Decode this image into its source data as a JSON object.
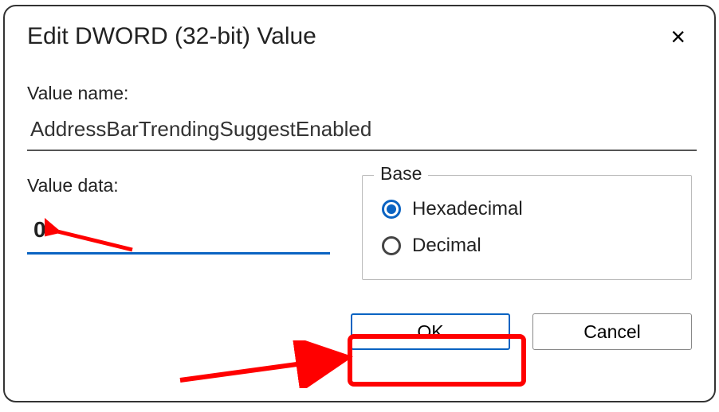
{
  "dialog": {
    "title": "Edit DWORD (32-bit) Value",
    "close_icon": "×"
  },
  "value_name": {
    "label": "Value name:",
    "value": "AddressBarTrendingSuggestEnabled"
  },
  "value_data": {
    "label": "Value data:",
    "value": "0"
  },
  "base": {
    "legend": "Base",
    "options": [
      {
        "label": "Hexadecimal",
        "selected": true
      },
      {
        "label": "Decimal",
        "selected": false
      }
    ]
  },
  "buttons": {
    "ok": "OK",
    "cancel": "Cancel"
  },
  "annotations": {
    "highlight_color": "#ff0000",
    "arrows": [
      "points-to-value-data",
      "points-to-ok"
    ]
  }
}
